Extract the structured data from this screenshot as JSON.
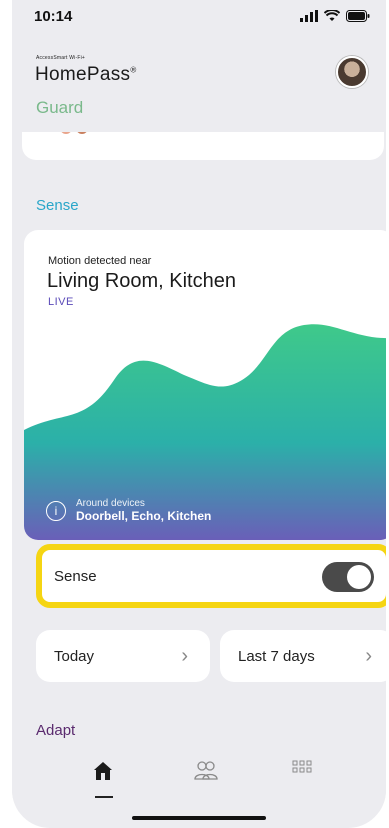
{
  "status_bar": {
    "time": "10:14"
  },
  "header": {
    "brand_small": "AccessSmart Wi-Fi+",
    "brand": "HomePass",
    "brand_mark": "®",
    "section": "Guard"
  },
  "sense": {
    "title": "Sense",
    "motion_label": "Motion detected near",
    "motion_rooms": "Living Room, Kitchen",
    "live_label": "LIVE",
    "around_label": "Around devices",
    "around_devices": "Doorbell, Echo, Kitchen",
    "toggle_label": "Sense",
    "toggle_on": true,
    "today_label": "Today",
    "week_label": "Last 7 days"
  },
  "adapt": {
    "title": "Adapt"
  },
  "colors": {
    "guard": "#7ab98b",
    "sense": "#29a6c9",
    "adapt": "#5a2a6e",
    "highlight": "#f5d513",
    "chart_top": "#3fc98a",
    "chart_bottom": "#6a5fb8"
  },
  "icons": {
    "tab_home": "home-icon",
    "tab_people": "people-icon",
    "tab_grid": "grid-icon"
  }
}
